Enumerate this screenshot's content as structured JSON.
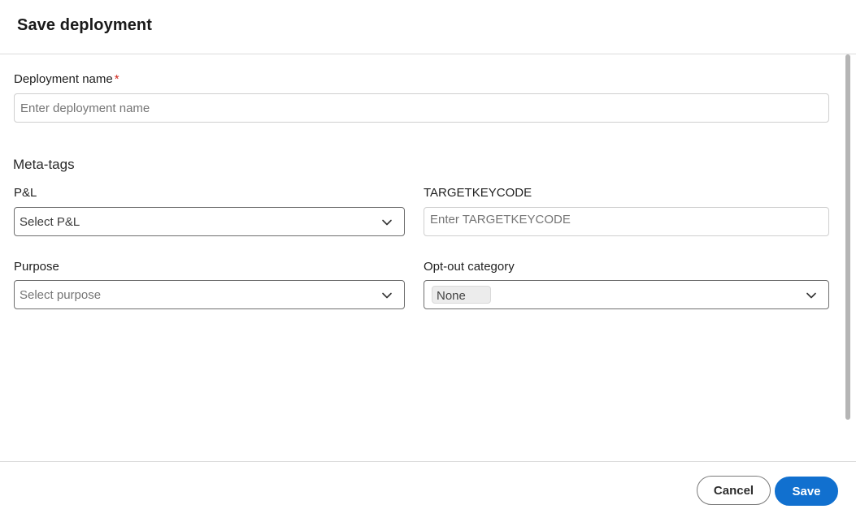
{
  "dialog": {
    "title": "Save deployment"
  },
  "form": {
    "deployment_name": {
      "label": "Deployment name",
      "required_marker": "*",
      "placeholder": "Enter deployment name"
    },
    "meta_tags_title": "Meta-tags",
    "pl": {
      "label": "P&L",
      "value": "Select P&L"
    },
    "targetkeycode": {
      "label": "TARGETKEYCODE",
      "placeholder": "Enter TARGETKEYCODE"
    },
    "purpose": {
      "label": "Purpose",
      "placeholder": "Select purpose"
    },
    "opt_out": {
      "label": "Opt-out category",
      "chip": "None"
    }
  },
  "footer": {
    "cancel_label": "Cancel",
    "save_label": "Save"
  },
  "icons": {
    "chevron": "chevron-down-icon"
  },
  "colors": {
    "primary": "#1170cf",
    "required": "#d0271d"
  }
}
